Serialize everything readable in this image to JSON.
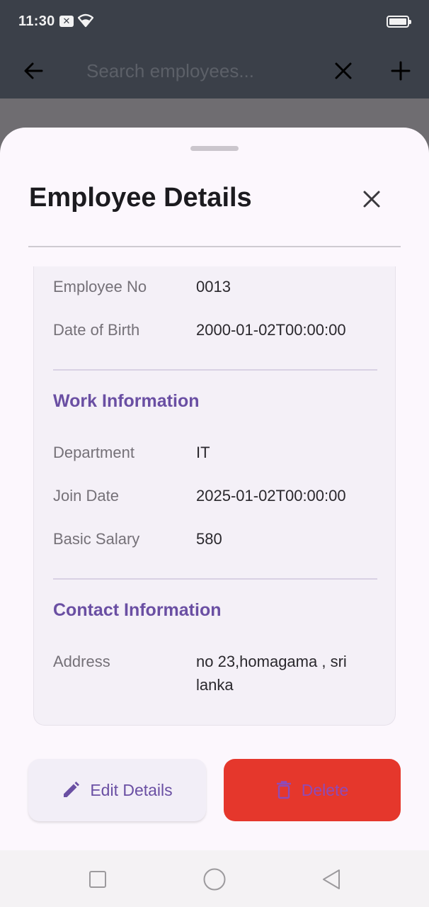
{
  "status_bar": {
    "time": "11:30"
  },
  "app_bar": {
    "search_placeholder": "Search employees..."
  },
  "sheet": {
    "title": "Employee Details",
    "personal": [
      {
        "label": "Employee No",
        "value": "0013"
      },
      {
        "label": "Date of Birth",
        "value": "2000-01-02T00:00:00"
      }
    ],
    "work": {
      "title": "Work Information",
      "rows": [
        {
          "label": "Department",
          "value": "IT"
        },
        {
          "label": "Join Date",
          "value": "2025-01-02T00:00:00"
        },
        {
          "label": "Basic Salary",
          "value": "580"
        }
      ]
    },
    "contact": {
      "title": "Contact Information",
      "rows": [
        {
          "label": "Address",
          "value": "no 23,homagama , sri lanka"
        }
      ]
    },
    "actions": {
      "edit_label": "Edit Details",
      "delete_label": "Delete"
    }
  },
  "colors": {
    "accent": "#6a4fa3",
    "danger": "#e5372c",
    "appbar": "#3b4049",
    "sheet": "#fcf7fd"
  },
  "icons": [
    "back-arrow-icon",
    "clear-icon",
    "add-icon",
    "close-icon",
    "edit-pencil-icon",
    "trash-icon",
    "wifi-icon",
    "battery-icon",
    "nav-square-icon",
    "nav-circle-icon",
    "nav-back-icon"
  ]
}
